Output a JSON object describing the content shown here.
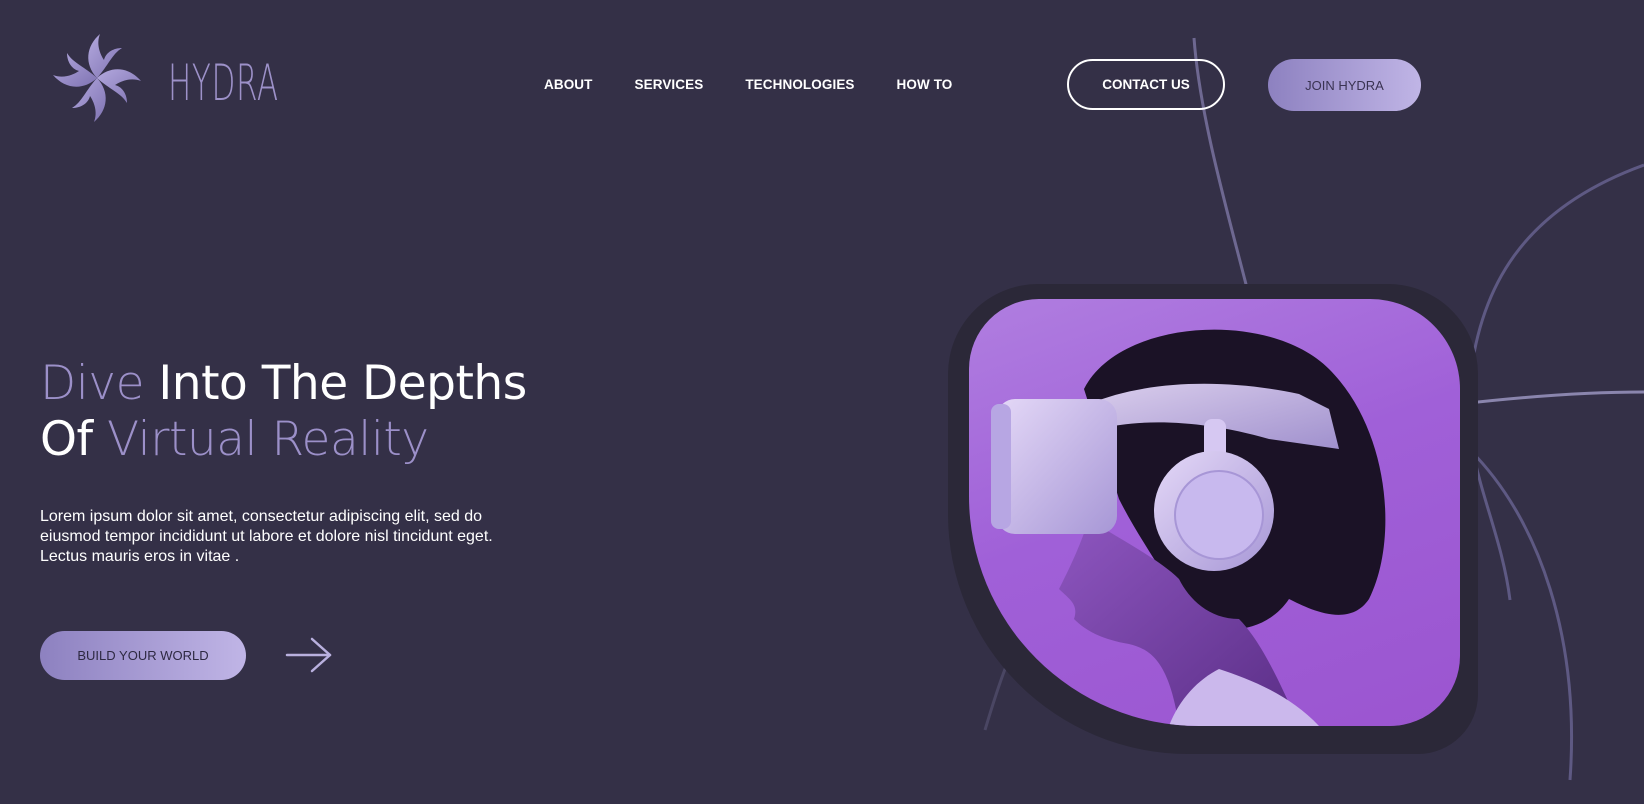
{
  "brand": {
    "name": "HYDRA",
    "accent_color": "#9c90c9",
    "background_color": "#343047"
  },
  "nav": {
    "items": [
      {
        "label": "ABOUT"
      },
      {
        "label": "SERVICES"
      },
      {
        "label": "TECHNOLOGIES"
      },
      {
        "label": "HOW TO"
      }
    ]
  },
  "header": {
    "contact_label": "CONTACT US",
    "join_label": "JOIN HYDRA"
  },
  "hero": {
    "title_line1_accent": "Dive",
    "title_line1_rest": " Into The Depths",
    "title_line2_strong": "Of",
    "title_line2_accent": " Virtual Reality",
    "description": "Lorem ipsum dolor sit amet, consectetur adipiscing elit, sed do eiusmod tempor incididunt ut labore et dolore nisl tincidunt eget. Lectus mauris eros in vitae .",
    "cta_label": "BUILD YOUR WORLD",
    "arrow_icon": "arrow-right-icon"
  },
  "image": {
    "subject": "vr-headset-person-photo"
  }
}
